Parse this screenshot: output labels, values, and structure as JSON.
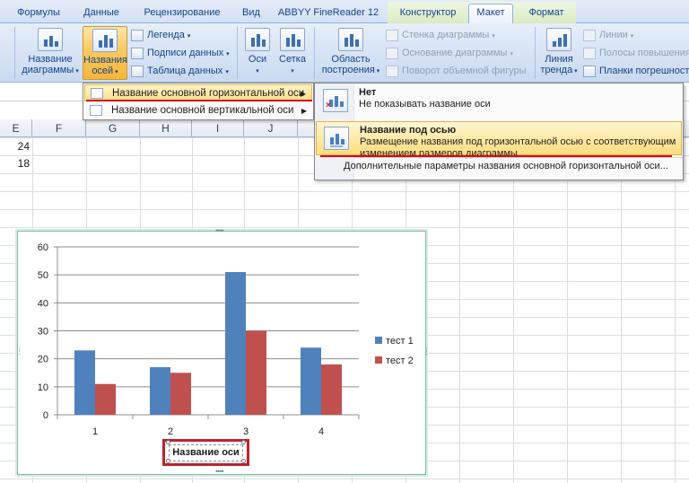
{
  "tabs": [
    "Формулы",
    "Данные",
    "Рецензирование",
    "Вид",
    "ABBYY FineReader 12",
    "Конструктор",
    "Макет",
    "Формат"
  ],
  "ribbon": {
    "chart_title_btn": "Название\nдиаграммы",
    "axis_titles_btn": "Названия\nосей",
    "legend": "Легенда",
    "data_labels": "Подписи данных",
    "data_table": "Таблица данных",
    "axes": "Оси",
    "gridlines": "Сетка",
    "plot_area": "Область\nпостроения",
    "chart_wall": "Стенка диаграммы",
    "chart_floor": "Основание диаграммы",
    "rotation_3d": "Поворот объемной фигуры",
    "trendline": "Линия\nтренда",
    "lines": "Линии",
    "up_down_bars": "Полосы повышения",
    "error_bars": "Планки погрешност"
  },
  "sheet": {
    "col_headers": [
      "E",
      "F",
      "G",
      "H",
      "I",
      "J"
    ],
    "values": [
      "24",
      "18"
    ]
  },
  "menu1": {
    "items": [
      "Название основной горизонтальной оси",
      "Название основной вертикальной оси"
    ]
  },
  "menu2": {
    "opt1_title": "Нет",
    "opt1_desc": "Не показывать название оси",
    "opt2_title": "Название под осью",
    "opt2_desc": "Размещение названия под горизонтальной осью с соответствующим изменением размеров диаграммы",
    "footer": "Дополнительные параметры названия основной горизонтальной оси..."
  },
  "chart_data": {
    "type": "bar",
    "categories": [
      "1",
      "2",
      "3",
      "4"
    ],
    "series": [
      {
        "name": "тест 1",
        "values": [
          23,
          17,
          51,
          24
        ],
        "color": "#4f81bd"
      },
      {
        "name": "тест 2",
        "values": [
          11,
          15,
          30,
          18
        ],
        "color": "#c0504d"
      }
    ],
    "ylim": [
      0,
      60
    ],
    "yticks": [
      "0",
      "10",
      "20",
      "30",
      "40",
      "50",
      "60"
    ],
    "xlabel": "Название оси",
    "legend": "right",
    "grid": true
  }
}
